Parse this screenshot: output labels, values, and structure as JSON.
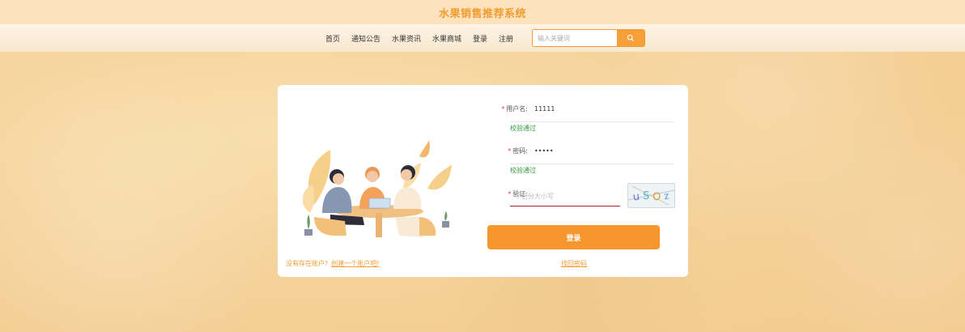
{
  "header": {
    "title": "水果销售推荐系统"
  },
  "nav": {
    "items": [
      "首页",
      "通知公告",
      "水果资讯",
      "水果商城",
      "登录",
      "注册"
    ],
    "search_placeholder": "输入关键词"
  },
  "login_form": {
    "username": {
      "label": "用户名:",
      "value": "11111",
      "status": "校验通过"
    },
    "password": {
      "label": "密码:",
      "value": "•••••",
      "status": "校验通过"
    },
    "captcha": {
      "label": "验证:",
      "placeholder": "不区分大小写",
      "image_text": "uSOz"
    },
    "login_button": "登录",
    "no_account_text": "没有存在账户?",
    "create_account_link": "创建一个账户吧!",
    "forgot_password_link": "找回密码"
  },
  "colors": {
    "accent": "#f7962d",
    "title": "#f29b2f",
    "success": "#2e9a3a",
    "required": "#e23d3d"
  }
}
